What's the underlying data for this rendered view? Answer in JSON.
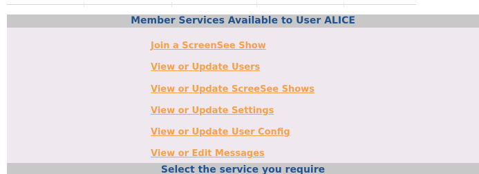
{
  "header": {
    "title": "Member Services Available to User ALICE"
  },
  "menu": {
    "items": [
      {
        "label": "Join a ScreenSee Show"
      },
      {
        "label": "View or Update Users"
      },
      {
        "label": "View or Update ScreeSee Shows"
      },
      {
        "label": "View or Update Settings"
      },
      {
        "label": "View or Update User Config"
      },
      {
        "label": "View or Edit Messages"
      }
    ]
  },
  "footer": {
    "text": "Select the service you require"
  },
  "colors": {
    "link": "#f5a04b",
    "heading_text": "#23528c",
    "bar_background": "#c8c8c8",
    "panel_background": "#efe9ef"
  }
}
